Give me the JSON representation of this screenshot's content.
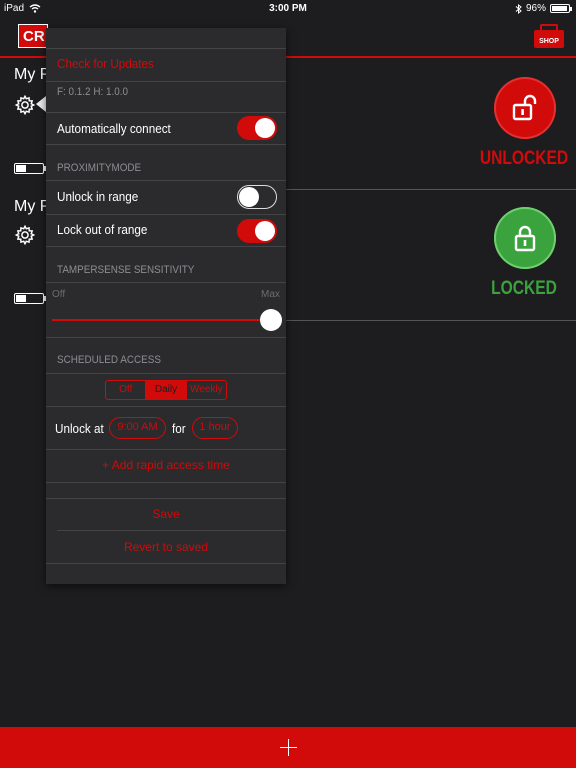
{
  "status_bar": {
    "device": "iPad",
    "time": "3:00 PM",
    "battery_percent": "96%",
    "battery_level": 0.96,
    "icons": [
      "wifi-icon",
      "bluetooth-icon",
      "battery-icon"
    ]
  },
  "header": {
    "logo_text": "CR",
    "shop_label": "SHOP"
  },
  "devices": [
    {
      "name": "My P",
      "state": "UNLOCKED",
      "state_color": "#d10a0a",
      "battery_level": 0.4
    },
    {
      "name": "My P",
      "state": "LOCKED",
      "state_color": "#3aa33d",
      "battery_level": 0.4
    }
  ],
  "panel": {
    "check_updates": "Check for Updates",
    "version_text": "F: 0.1.2  H: 1.0.0",
    "auto_connect": {
      "label": "Automatically connect",
      "on": true
    },
    "proximity_title": "PROXIMITYMODE",
    "unlock_in_range": {
      "label": "Unlock in range",
      "on": false
    },
    "lock_out_of_range": {
      "label": "Lock out of range",
      "on": true
    },
    "tampersense_title": "TAMPERSENSE SENSITIVITY",
    "slider": {
      "min_label": "Off",
      "max_label": "Max",
      "value": 1.0
    },
    "scheduled_title": "SCHEDULED ACCESS",
    "schedule_options": [
      "Off",
      "Daily",
      "Weekly"
    ],
    "schedule_selected": "Daily",
    "unlock_at_label": "Unlock at",
    "unlock_time": "9:00 AM",
    "for_label": "for",
    "duration": "1 hour",
    "add_rapid": "+ Add rapid access time",
    "save": "Save",
    "revert": "Revert to saved"
  },
  "colors": {
    "accent": "#d10a0a",
    "locked": "#3aa33d",
    "background": "#1d1d1f",
    "panel": "#2b2b2d"
  }
}
